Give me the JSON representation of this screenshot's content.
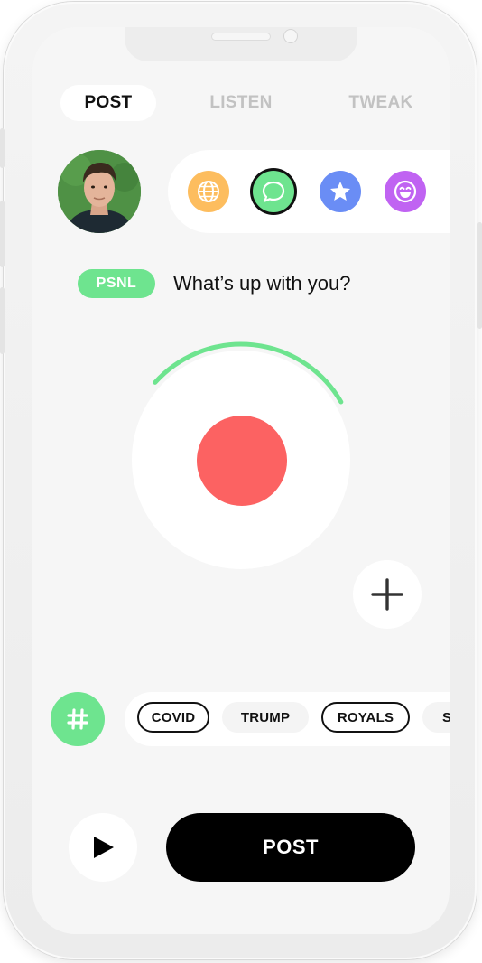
{
  "tabs": [
    {
      "label": "POST",
      "active": true
    },
    {
      "label": "LISTEN",
      "active": false
    },
    {
      "label": "TWEAK",
      "active": false
    }
  ],
  "profile": {
    "avatar_icon": "user-avatar"
  },
  "categories": [
    {
      "icon": "globe-icon",
      "color": "#fdbd5e",
      "selected": false
    },
    {
      "icon": "chat-bubble-icon",
      "color": "#6ee48f",
      "selected": true
    },
    {
      "icon": "star-icon",
      "color": "#6a8df5",
      "selected": false
    },
    {
      "icon": "smiley-icon",
      "color": "#c063f2",
      "selected": false
    }
  ],
  "prompt": {
    "badge": "PSNL",
    "text": "What’s up with you?"
  },
  "recorder": {
    "progress": 0.3,
    "ring_color": "#6ee48f",
    "record_color": "#fc6262"
  },
  "tags": [
    {
      "label": "COVID",
      "style": "outlined"
    },
    {
      "label": "TRUMP",
      "style": "filled"
    },
    {
      "label": "ROYALS",
      "style": "outlined"
    },
    {
      "label": "S",
      "style": "filled"
    }
  ],
  "actions": {
    "post_label": "POST"
  },
  "colors": {
    "accent": "#6ee48f",
    "record": "#fc6262",
    "primary_button": "#000000"
  }
}
